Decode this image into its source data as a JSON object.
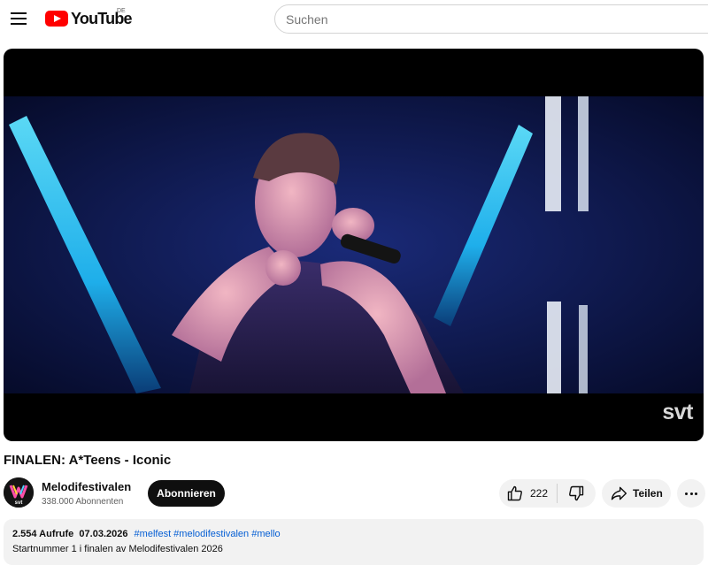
{
  "header": {
    "logo_text": "YouTube",
    "country_code": "DE",
    "search_placeholder": "Suchen"
  },
  "player": {
    "watermark": "svt"
  },
  "video": {
    "title": "FINALEN: A*Teens - Iconic"
  },
  "channel": {
    "name": "Melodifestivalen",
    "subscribers": "338.000 Abonnenten",
    "avatar_text": "svt",
    "subscribe_label": "Abonnieren"
  },
  "actions": {
    "like_count": "222",
    "share_label": "Teilen"
  },
  "description": {
    "views": "2.554 Aufrufe",
    "date": "07.03.2026",
    "hashtags": "#melfest #melodifestivalen #mello",
    "text": "Startnummer 1 i finalen av Melodifestivalen 2026"
  },
  "colors": {
    "brand_red": "#ff0000",
    "link_blue": "#065fd4",
    "subscribe_bg": "#0f0f0f",
    "chip_bg": "#f2f2f2"
  }
}
